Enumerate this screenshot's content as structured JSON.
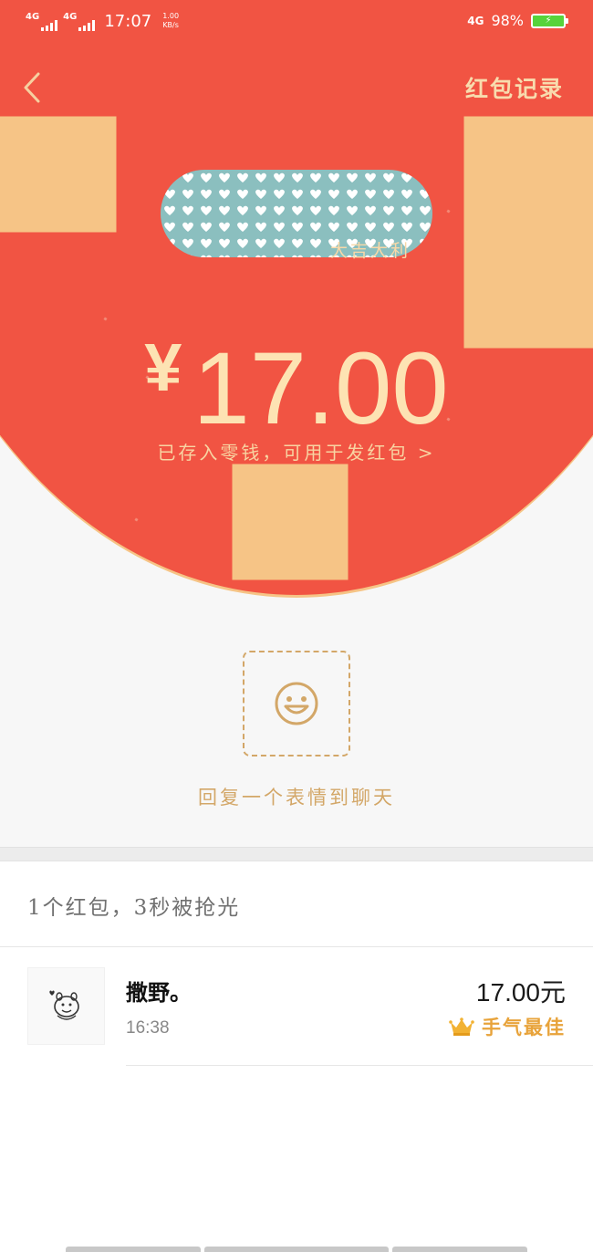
{
  "status_bar": {
    "network_left_1": "4G",
    "network_left_2": "4G",
    "time": "17:07",
    "speed_value": "1.00",
    "speed_unit": "KB/s",
    "network_right": "4G",
    "battery_percent": "98%"
  },
  "header": {
    "back_icon": "chevron-left-icon",
    "records_label": "红包记录"
  },
  "envelope": {
    "wish": "大吉大利",
    "currency": "¥",
    "amount": "17.00",
    "saved_note": "已存入零钱，可用于发红包 >"
  },
  "reply": {
    "emoji_icon": "smiley-icon",
    "label": "回复一个表情到聊天"
  },
  "summary": "1个红包，3秒被抢光",
  "records": [
    {
      "name": "撒野。",
      "time": "16:38",
      "amount": "17.00元",
      "badge": "手气最佳",
      "badge_icon": "crown-icon"
    }
  ],
  "colors": {
    "header_red": "#f15443",
    "gold_text": "#fde3b3",
    "accent_gold": "#d3a768",
    "badge_gold": "#e8a33a"
  }
}
